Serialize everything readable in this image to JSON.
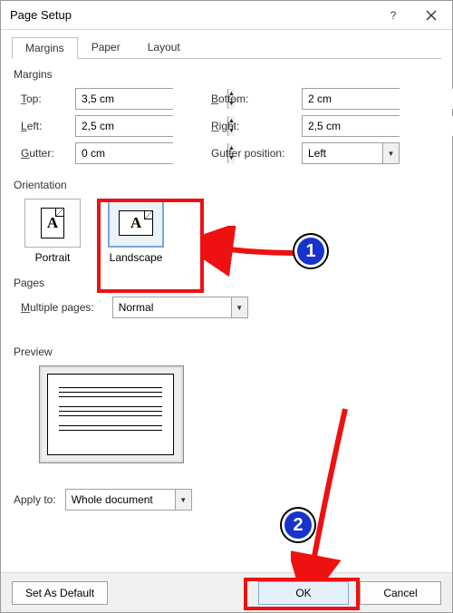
{
  "title": "Page Setup",
  "tabs": {
    "margins": "Margins",
    "paper": "Paper",
    "layout": "Layout"
  },
  "section": {
    "margins": "Margins",
    "orientation": "Orientation",
    "pages": "Pages",
    "preview": "Preview"
  },
  "labels": {
    "top": "Top:",
    "bottom": "Bottom:",
    "left": "Left:",
    "right": "Right:",
    "gutter": "Gutter:",
    "gutter_pos": "Gutter position:",
    "portrait": "Portrait",
    "landscape": "Landscape",
    "multiple_pages": "Multiple pages:",
    "apply_to": "Apply to:"
  },
  "values": {
    "top": "3,5 cm",
    "bottom": "2 cm",
    "left": "2,5 cm",
    "right": "2,5 cm",
    "gutter": "0 cm",
    "gutter_pos": "Left",
    "multiple_pages": "Normal",
    "apply_to": "Whole document"
  },
  "buttons": {
    "set_default": "Set As Default",
    "ok": "OK",
    "cancel": "Cancel"
  },
  "annotations": {
    "num1": "1",
    "num2": "2"
  }
}
